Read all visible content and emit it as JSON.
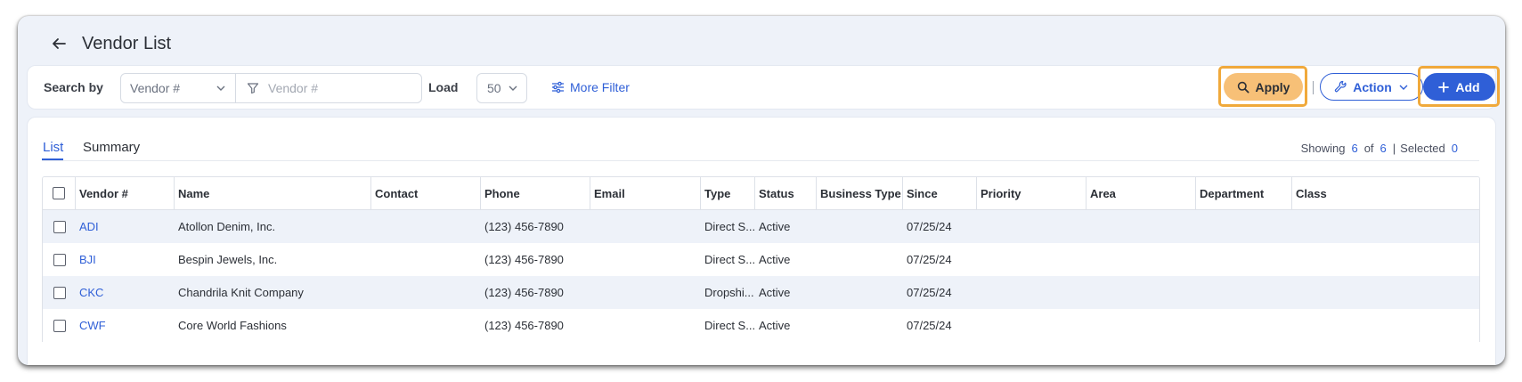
{
  "header": {
    "title": "Vendor List"
  },
  "toolbar": {
    "search_by_label": "Search by",
    "search_field_value": "Vendor #",
    "search_placeholder": "Vendor #",
    "load_label": "Load",
    "load_value": "50",
    "more_filter_label": "More Filter",
    "apply_label": "Apply",
    "action_label": "Action",
    "add_label": "Add"
  },
  "tabs": [
    {
      "label": "List",
      "active": true
    },
    {
      "label": "Summary",
      "active": false
    }
  ],
  "summary": {
    "showing_label": "Showing",
    "showing_count": "6",
    "of_label": "of",
    "total_count": "6",
    "selected_label": "Selected",
    "selected_count": "0"
  },
  "table": {
    "columns": [
      "Vendor #",
      "Name",
      "Contact",
      "Phone",
      "Email",
      "Type",
      "Status",
      "Business Type",
      "Since",
      "Priority",
      "Area",
      "Department",
      "Class"
    ],
    "rows": [
      {
        "vendor": "ADI",
        "name": "Atollon Denim, Inc.",
        "contact": "",
        "phone": "(123) 456-7890",
        "email": "",
        "type": "Direct S...",
        "status": "Active",
        "business_type": "",
        "since": "07/25/24",
        "priority": "",
        "area": "",
        "department": "",
        "class": ""
      },
      {
        "vendor": "BJI",
        "name": "Bespin Jewels, Inc.",
        "contact": "",
        "phone": "(123) 456-7890",
        "email": "",
        "type": "Direct S...",
        "status": "Active",
        "business_type": "",
        "since": "07/25/24",
        "priority": "",
        "area": "",
        "department": "",
        "class": ""
      },
      {
        "vendor": "CKC",
        "name": "Chandrila Knit Company",
        "contact": "",
        "phone": "(123) 456-7890",
        "email": "",
        "type": "Dropshi...",
        "status": "Active",
        "business_type": "",
        "since": "07/25/24",
        "priority": "",
        "area": "",
        "department": "",
        "class": ""
      },
      {
        "vendor": "CWF",
        "name": "Core World Fashions",
        "contact": "",
        "phone": "(123) 456-7890",
        "email": "",
        "type": "Direct S...",
        "status": "Active",
        "business_type": "",
        "since": "07/25/24",
        "priority": "",
        "area": "",
        "department": "",
        "class": ""
      }
    ]
  },
  "colors": {
    "accent": "#2f5fd7",
    "apply_button": "#f7c077",
    "highlight_outline": "#f0a93b",
    "row_stripe": "#eef2f9"
  },
  "icons": [
    "back-arrow-icon",
    "chevron-down-icon",
    "filter-funnel-icon",
    "sliders-icon",
    "search-icon",
    "wrench-icon",
    "plus-icon"
  ]
}
